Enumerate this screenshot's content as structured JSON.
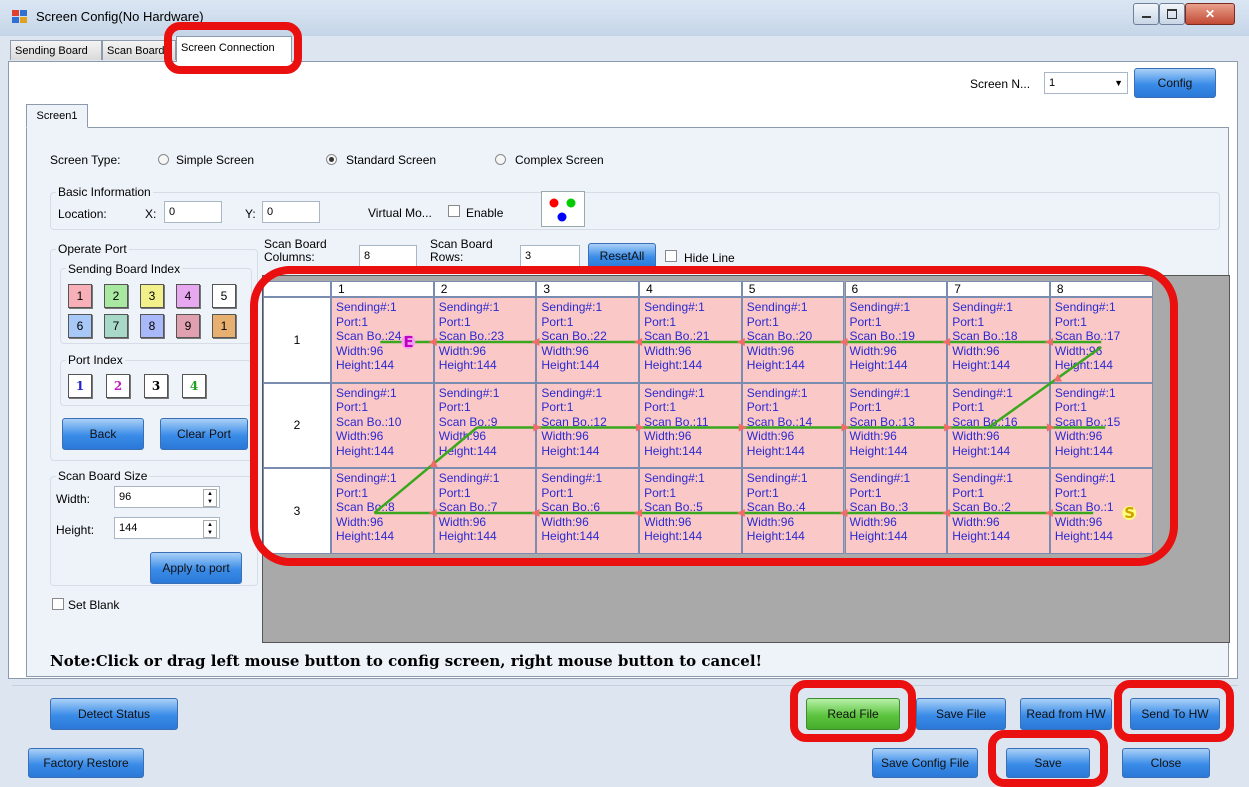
{
  "window": {
    "title": "Screen Config(No Hardware)",
    "app_icon": "app-window-icon",
    "controls": [
      "minimize-icon",
      "maximize-icon",
      "close-icon"
    ]
  },
  "tabs": [
    {
      "label": "Sending Board",
      "active": false
    },
    {
      "label": "Scan Board",
      "active": false
    },
    {
      "label": "Screen Connection",
      "active": true
    }
  ],
  "header": {
    "screen_label": "Screen N...",
    "screen_value": "1",
    "config_button": "Config"
  },
  "screen_tab": "Screen1",
  "screen_type": {
    "label": "Screen Type:",
    "options": [
      {
        "label": "Simple Screen",
        "selected": false
      },
      {
        "label": "Standard Screen",
        "selected": true
      },
      {
        "label": "Complex Screen",
        "selected": false
      }
    ]
  },
  "basic_info": {
    "title": "Basic Information",
    "location_label": "Location:",
    "x_label": "X:",
    "x_value": "0",
    "y_label": "Y:",
    "y_value": "0",
    "virtual_label": "Virtual Mo...",
    "enable_label": "Enable",
    "enable_checked": false,
    "dot_colors": [
      "#ff0000",
      "#00cc00",
      "#0000ff"
    ]
  },
  "operate_port": {
    "title": "Operate Port",
    "sending_title": "Sending Board Index",
    "sending_indices": [
      {
        "label": "1",
        "color": "#f7b0b8"
      },
      {
        "label": "2",
        "color": "#a8e8a0"
      },
      {
        "label": "3",
        "color": "#f2f08a"
      },
      {
        "label": "4",
        "color": "#e8a8f0"
      },
      {
        "label": "5",
        "color": "#ffffff"
      },
      {
        "label": "6",
        "color": "#a8c8f8"
      },
      {
        "label": "7",
        "color": "#a8d8c8"
      },
      {
        "label": "8",
        "color": "#a8b8f8"
      },
      {
        "label": "9",
        "color": "#e0a0b0"
      },
      {
        "label": "1",
        "color": "#e8b070"
      }
    ],
    "port_title": "Port Index",
    "port_indices": [
      {
        "label": "1",
        "color": "#2020d0"
      },
      {
        "label": "2",
        "color": "#c020c0"
      },
      {
        "label": "3",
        "color": "#000000"
      },
      {
        "label": "4",
        "color": "#20a020"
      }
    ],
    "back_button": "Back",
    "clear_button": "Clear Port"
  },
  "scan_size": {
    "title": "Scan Board Size",
    "width_label": "Width:",
    "width_value": "96",
    "height_label": "Height:",
    "height_value": "144",
    "apply_button": "Apply to port"
  },
  "set_blank_label": "Set Blank",
  "scan_config": {
    "columns_label": "Scan Board Columns:",
    "columns_value": "8",
    "rows_label": "Scan Board Rows:",
    "rows_value": "3",
    "reset_button": "ResetAll",
    "hide_line_label": "Hide Line"
  },
  "grid": {
    "columns": [
      "1",
      "2",
      "3",
      "4",
      "5",
      "6",
      "7",
      "8"
    ],
    "rows": [
      "1",
      "2",
      "3"
    ],
    "cell_common": {
      "sending": "Sending#:1",
      "port": "Port:1",
      "width": "Width:96",
      "height": "Height:144"
    },
    "scan_labels": [
      [
        "Scan Bo.:24",
        "Scan Bo.:23",
        "Scan Bo.:22",
        "Scan Bo.:21",
        "Scan Bo.:20",
        "Scan Bo.:19",
        "Scan Bo.:18",
        "Scan Bo.:17"
      ],
      [
        "Scan Bo.:10",
        "Scan Bo.:9",
        "Scan Bo.:12",
        "Scan Bo.:11",
        "Scan Bo.:14",
        "Scan Bo.:13",
        "Scan Bo.:16",
        "Scan Bo.:15"
      ],
      [
        "Scan Bo.:8",
        "Scan Bo.:7",
        "Scan Bo.:6",
        "Scan Bo.:5",
        "Scan Bo.:4",
        "Scan Bo.:3",
        "Scan Bo.:2",
        "Scan Bo.:1"
      ]
    ],
    "start_marker": "S",
    "end_marker": "E",
    "line_color": "#3aa81e",
    "arrow_color": "#f26a6a"
  },
  "note": "Note:Click or drag left mouse button to config screen, right mouse button to cancel!",
  "footer": {
    "detect_status": "Detect Status",
    "read_file": "Read File",
    "save_file": "Save File",
    "read_from_hw": "Read from HW",
    "send_to_hw": "Send To HW",
    "factory_restore": "Factory Restore",
    "save_config_file": "Save Config File",
    "save": "Save",
    "close": "Close"
  },
  "highlight_color": "#ea1010"
}
